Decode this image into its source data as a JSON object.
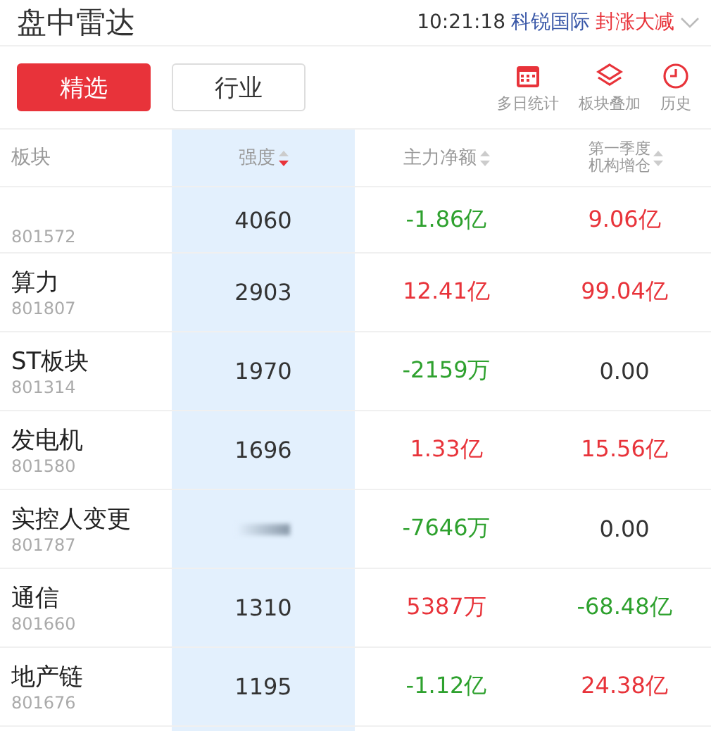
{
  "header": {
    "title": "盘中雷达",
    "time": "10:21:18",
    "stock": "科锐国际",
    "event": "封涨大减"
  },
  "tabs": [
    {
      "label": "精选",
      "selected": true
    },
    {
      "label": "行业",
      "selected": false
    }
  ],
  "tools": [
    {
      "kind": "calendar",
      "label": "多日统计"
    },
    {
      "kind": "layers",
      "label": "板块叠加"
    },
    {
      "kind": "clock",
      "label": "历史"
    }
  ],
  "table": {
    "columns": [
      {
        "label": "板块",
        "kind": "plain"
      },
      {
        "label": "强度",
        "kind": "sortable",
        "sorted": true
      },
      {
        "label": "主力净额",
        "kind": "sortable",
        "sorted": false
      },
      {
        "label": "第一季度机构增仓",
        "kind": "sortable",
        "sorted": false
      }
    ],
    "rows": [
      {
        "code": "801572",
        "strength": "4060",
        "net": {
          "text": "-1.86亿",
          "color": "#2ea12e"
        },
        "inst": {
          "text": "9.06亿",
          "color": "#e8333a"
        }
      },
      {
        "name": "算力",
        "code": "801807",
        "strength": "2903",
        "net": {
          "text": "12.41亿",
          "color": "#e8333a"
        },
        "inst": {
          "text": "99.04亿",
          "color": "#e8333a"
        }
      },
      {
        "name": "ST板块",
        "code": "801314",
        "strength": "1970",
        "net": {
          "text": "-2159万",
          "color": "#2ea12e"
        },
        "inst": {
          "text": "0.00",
          "color": "#333333"
        }
      },
      {
        "name": "发电机",
        "code": "801580",
        "strength": "1696",
        "net": {
          "text": "1.33亿",
          "color": "#e8333a"
        },
        "inst": {
          "text": "15.56亿",
          "color": "#e8333a"
        }
      },
      {
        "name": "实控人变更",
        "code": "801787",
        "net": {
          "text": "-7646万",
          "color": "#2ea12e"
        },
        "inst": {
          "text": "0.00",
          "color": "#333333"
        }
      },
      {
        "name": "通信",
        "code": "801660",
        "strength": "1310",
        "net": {
          "text": "5387万",
          "color": "#e8333a"
        },
        "inst": {
          "text": "-68.48亿",
          "color": "#2ea12e"
        }
      },
      {
        "name": "地产链",
        "code": "801676",
        "strength": "1195",
        "net": {
          "text": "-1.12亿",
          "color": "#2ea12e"
        },
        "inst": {
          "text": "24.38亿",
          "color": "#e8333a"
        }
      }
    ]
  }
}
